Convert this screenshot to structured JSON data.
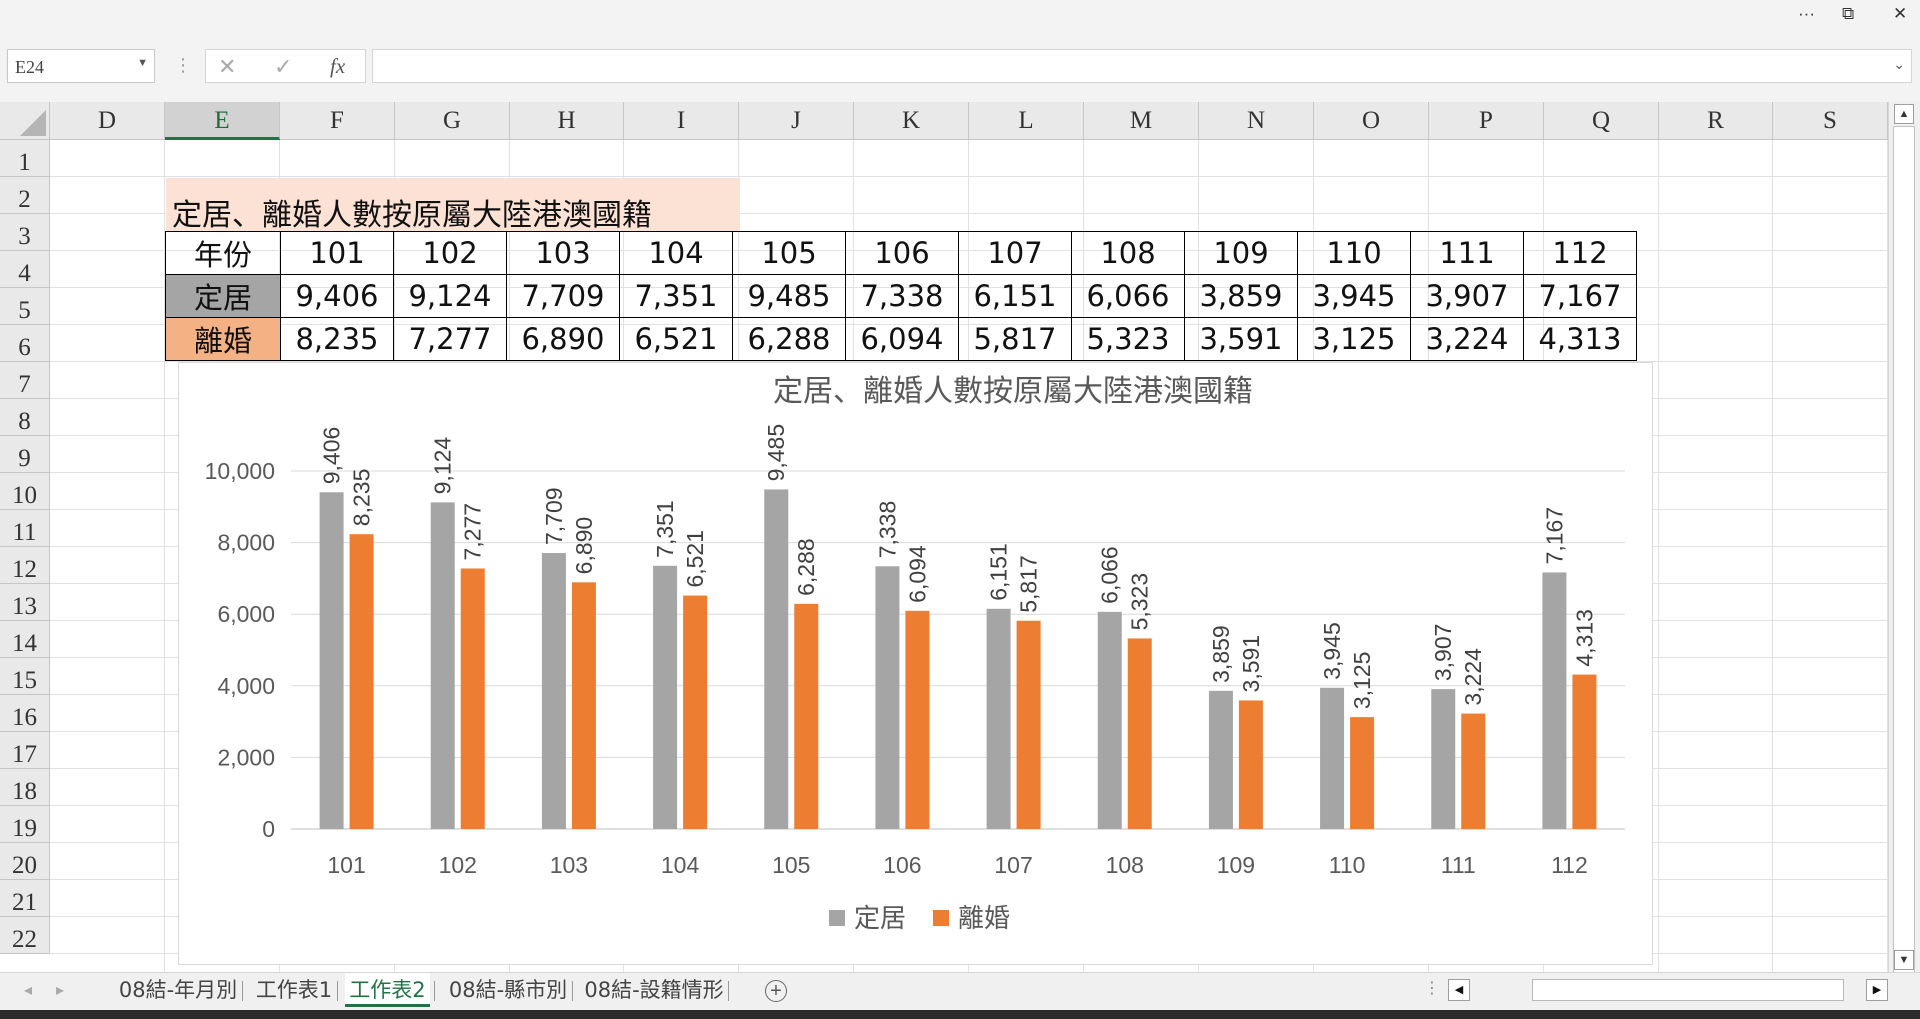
{
  "window_controls": {
    "more": "···",
    "restore": "⧉",
    "close": "✕"
  },
  "formula_bar": {
    "name_box": "E24",
    "cancel_icon": "✕",
    "enter_icon": "✓",
    "fx_label": "fx",
    "formula_value": ""
  },
  "columns": [
    "D",
    "E",
    "F",
    "G",
    "H",
    "I",
    "J",
    "K",
    "L",
    "M",
    "N",
    "O",
    "P",
    "Q",
    "R",
    "S"
  ],
  "selected_column": "E",
  "rows": [
    "1",
    "2",
    "3",
    "4",
    "5",
    "6",
    "7",
    "8",
    "9",
    "10",
    "11",
    "12",
    "13",
    "14",
    "15",
    "16",
    "17",
    "18",
    "19",
    "20",
    "21",
    "22"
  ],
  "sheet": {
    "title": "定居、離婚人數按原屬大陸港澳國籍",
    "header_label": "年份",
    "years": [
      "101",
      "102",
      "103",
      "104",
      "105",
      "106",
      "107",
      "108",
      "109",
      "110",
      "111",
      "112"
    ],
    "row_settle": {
      "label": "定居",
      "values": [
        "9,406",
        "9,124",
        "7,709",
        "7,351",
        "9,485",
        "7,338",
        "6,151",
        "6,066",
        "3,859",
        "3,945",
        "3,907",
        "7,167"
      ]
    },
    "row_divorce": {
      "label": "離婚",
      "values": [
        "8,235",
        "7,277",
        "6,890",
        "6,521",
        "6,288",
        "6,094",
        "5,817",
        "5,323",
        "3,591",
        "3,125",
        "3,224",
        "4,313"
      ]
    }
  },
  "chart_data": {
    "type": "bar",
    "title": "定居、離婚人數按原屬大陸港澳國籍",
    "categories": [
      "101",
      "102",
      "103",
      "104",
      "105",
      "106",
      "107",
      "108",
      "109",
      "110",
      "111",
      "112"
    ],
    "series": [
      {
        "name": "定居",
        "color": "#a5a5a5",
        "values": [
          9406,
          9124,
          7709,
          7351,
          9485,
          7338,
          6151,
          6066,
          3859,
          3945,
          3907,
          7167
        ]
      },
      {
        "name": "離婚",
        "color": "#ed7d31",
        "values": [
          8235,
          7277,
          6890,
          6521,
          6288,
          6094,
          5817,
          5323,
          3591,
          3125,
          3224,
          4313
        ]
      }
    ],
    "y_ticks": [
      "0",
      "2,000",
      "4,000",
      "6,000",
      "8,000",
      "10,000"
    ],
    "ylim": [
      0,
      10000
    ],
    "xlabel": "",
    "ylabel": "",
    "data_labels": "rotated vertical above bars",
    "grid": true,
    "legend": "bottom"
  },
  "tabs": [
    {
      "label": "08結-年月別",
      "active": false
    },
    {
      "label": "工作表1",
      "active": false
    },
    {
      "label": "工作表2",
      "active": true
    },
    {
      "label": "08結-縣市別",
      "active": false
    },
    {
      "label": "08結-設籍情形",
      "active": false
    }
  ],
  "add_sheet": "+"
}
